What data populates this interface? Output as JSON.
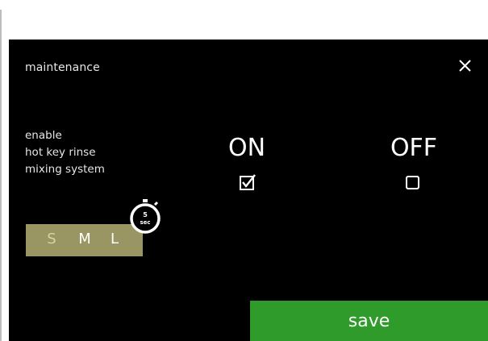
{
  "screen": {
    "title": "maintenance",
    "close_icon": "close-icon",
    "description": {
      "line1": "enable",
      "line2": "hot key rinse",
      "line3": "mixing system"
    },
    "options": {
      "on_label": "ON",
      "off_label": "OFF",
      "on_checked": true,
      "off_checked": false
    },
    "size_selector": {
      "small": "S",
      "medium": "M",
      "large": "L",
      "selected": "S"
    },
    "timer": {
      "value": "5",
      "unit": "sec",
      "icon": "stopwatch-icon"
    },
    "save_label": "save"
  },
  "colors": {
    "screen_bg": "#000000",
    "accent_green": "#2f9b2b",
    "size_bar": "#9a9663",
    "text": "#e6e6e6"
  }
}
